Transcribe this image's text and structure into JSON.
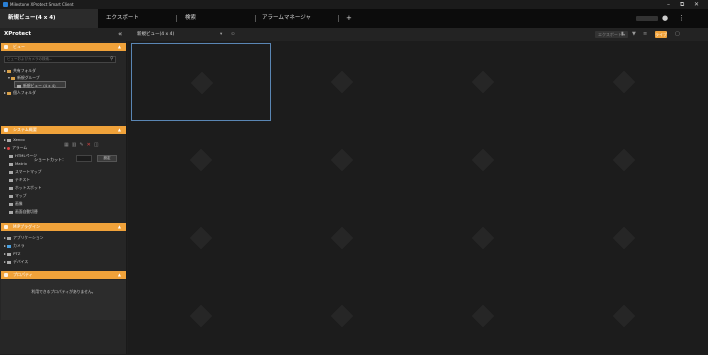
{
  "window": {
    "title": "Milestone XProtect Smart Client",
    "minimize": "–",
    "maximize": "⧉",
    "close": "✕"
  },
  "tabs": [
    {
      "label": "新規ビュー(4 x 4)",
      "active": true
    },
    {
      "label": "エクスポート",
      "active": false
    },
    {
      "label": "検索",
      "active": false
    },
    {
      "label": "アラームマネージャ",
      "active": false
    },
    {
      "label": "+",
      "active": false
    }
  ],
  "tabbar_right": {
    "user_icon": "user-icon",
    "menu_icon": "more-vertical-icon"
  },
  "toolbar": {
    "app_title": "XProtect",
    "collapse": "«",
    "view_label": "新規ビュー(4 x 4)",
    "view_caret": "▾",
    "camera_icon": "⊙",
    "export_label": "エクスポート ▾",
    "live_label": "ライブ"
  },
  "sidebar": {
    "views": {
      "title": "ビュー",
      "search_placeholder": "ビューおよびカメラの検索...",
      "tree": [
        {
          "label": "共有フォルダ",
          "indent": 0
        },
        {
          "label": "新規グループ",
          "indent": 1
        },
        {
          "label": "新規ビュー (4 x 4)",
          "indent": 2,
          "selected": true
        },
        {
          "label": "個人フォルダ",
          "indent": 0
        }
      ],
      "shortcut_label": "ショートカット：",
      "set_button": "設定"
    },
    "system_overview": {
      "title": "システム概要",
      "items": [
        {
          "label": "Xenco",
          "glyph": "w"
        },
        {
          "label": "アラーム",
          "glyph": "r"
        },
        {
          "label": "HTMLページ",
          "glyph": "w"
        },
        {
          "label": "Matrix",
          "glyph": "w"
        },
        {
          "label": "スマートマップ",
          "glyph": "w"
        },
        {
          "label": "テキスト",
          "glyph": "w"
        },
        {
          "label": "ホットスポット",
          "glyph": "w"
        },
        {
          "label": "マップ",
          "glyph": "w"
        },
        {
          "label": "画像",
          "glyph": "w"
        },
        {
          "label": "画面自動切替",
          "glyph": "w"
        }
      ]
    },
    "mip_plugins": {
      "title": "MIPプラグイン",
      "items": [
        {
          "label": "アプリケーション"
        },
        {
          "label": "カメラ"
        },
        {
          "label": "PTZ"
        },
        {
          "label": "デバイス"
        }
      ]
    },
    "properties": {
      "title": "プロパティ",
      "empty_message": "利用できるプロパティがありません。"
    }
  },
  "grid": {
    "rows": 4,
    "cols": 4,
    "active_cell": 0
  }
}
